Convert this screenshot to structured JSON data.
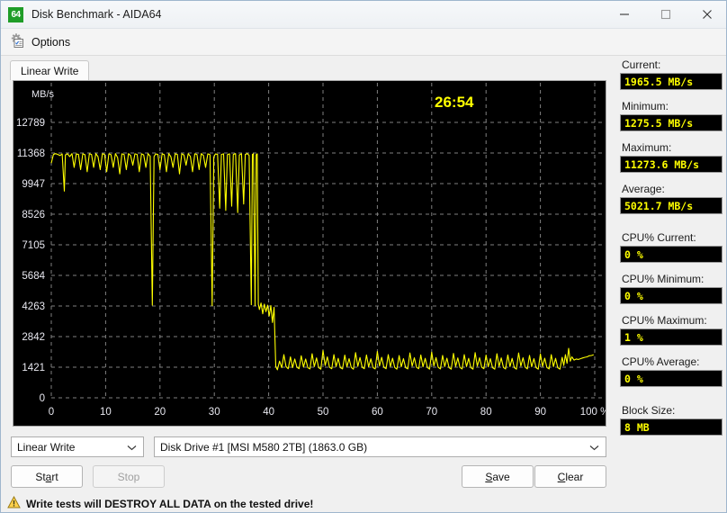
{
  "window": {
    "title": "Disk Benchmark - AIDA64",
    "app_icon": "64",
    "minimize_icon": "minimize-icon",
    "maximize_icon": "maximize-icon",
    "close_icon": "close-icon"
  },
  "toolbar": {
    "options_label": "Options",
    "options_icon": "gear-checklist-icon"
  },
  "tabs": [
    {
      "label": "Linear Write",
      "active": true
    }
  ],
  "chart": {
    "timer": "26:54",
    "y_axis_unit": "MB/s",
    "x_axis_unit": "%"
  },
  "chart_data": {
    "type": "line",
    "title": "Linear Write",
    "xlabel": "%",
    "ylabel": "MB/s",
    "xlim": [
      0,
      100
    ],
    "ylim": [
      0,
      14210
    ],
    "grid": true,
    "legend": "none",
    "line_color": "#ffff00",
    "background": "#000000",
    "gridline_color": "#808080",
    "xticks": [
      0,
      10,
      20,
      30,
      40,
      50,
      60,
      70,
      80,
      90,
      100
    ],
    "xtick_labels": [
      "0",
      "10",
      "20",
      "30",
      "40",
      "50",
      "60",
      "70",
      "80",
      "90",
      "100 %"
    ],
    "yticks": [
      0,
      1421,
      2842,
      4263,
      5684,
      7105,
      8526,
      9947,
      11368,
      12789
    ],
    "ytick_labels": [
      "0",
      "1421",
      "2842",
      "4263",
      "5684",
      "7105",
      "8526",
      "9947",
      "11368",
      "12789"
    ],
    "annotations": [
      {
        "text": "26:54",
        "x": 72,
        "y": 13400,
        "color": "#ffff00"
      }
    ],
    "series": [
      {
        "name": "Linear Write speed",
        "points": [
          [
            0.0,
            10900
          ],
          [
            0.4,
            11300
          ],
          [
            0.8,
            11340
          ],
          [
            1.2,
            11300
          ],
          [
            1.6,
            11250
          ],
          [
            2.0,
            11320
          ],
          [
            2.4,
            9600
          ],
          [
            2.6,
            11280
          ],
          [
            3.0,
            11330
          ],
          [
            3.4,
            11200
          ],
          [
            3.8,
            11340
          ],
          [
            4.2,
            10700
          ],
          [
            4.6,
            11320
          ],
          [
            5.0,
            11300
          ],
          [
            5.4,
            10600
          ],
          [
            5.8,
            11330
          ],
          [
            6.2,
            11290
          ],
          [
            6.6,
            10500
          ],
          [
            7.0,
            11330
          ],
          [
            7.4,
            11300
          ],
          [
            7.8,
            10700
          ],
          [
            8.2,
            11340
          ],
          [
            8.6,
            11200
          ],
          [
            9.0,
            10600
          ],
          [
            9.4,
            11330
          ],
          [
            9.8,
            11310
          ],
          [
            10.2,
            10500
          ],
          [
            10.6,
            11330
          ],
          [
            11.0,
            11290
          ],
          [
            11.4,
            10700
          ],
          [
            11.8,
            11340
          ],
          [
            12.2,
            11160
          ],
          [
            12.6,
            10400
          ],
          [
            13.0,
            11330
          ],
          [
            13.4,
            11300
          ],
          [
            13.8,
            10600
          ],
          [
            14.2,
            11340
          ],
          [
            14.6,
            11250
          ],
          [
            15.0,
            10800
          ],
          [
            15.4,
            11330
          ],
          [
            15.8,
            11300
          ],
          [
            16.2,
            10500
          ],
          [
            16.6,
            11330
          ],
          [
            17.0,
            11280
          ],
          [
            17.4,
            10700
          ],
          [
            17.8,
            11340
          ],
          [
            18.2,
            11220
          ],
          [
            18.6,
            4300
          ],
          [
            18.9,
            11200
          ],
          [
            19.2,
            11320
          ],
          [
            19.6,
            11300
          ],
          [
            20.0,
            10600
          ],
          [
            20.4,
            11330
          ],
          [
            20.8,
            11290
          ],
          [
            21.2,
            10500
          ],
          [
            21.6,
            11340
          ],
          [
            22.0,
            11200
          ],
          [
            22.4,
            10700
          ],
          [
            22.8,
            11330
          ],
          [
            23.2,
            11300
          ],
          [
            23.6,
            10400
          ],
          [
            24.0,
            11330
          ],
          [
            24.4,
            11280
          ],
          [
            24.8,
            10800
          ],
          [
            25.2,
            11340
          ],
          [
            25.6,
            11210
          ],
          [
            26.0,
            10500
          ],
          [
            26.4,
            11330
          ],
          [
            26.8,
            11300
          ],
          [
            27.2,
            10600
          ],
          [
            27.6,
            11340
          ],
          [
            28.0,
            11250
          ],
          [
            28.4,
            10700
          ],
          [
            28.8,
            11330
          ],
          [
            29.2,
            11290
          ],
          [
            29.6,
            4280
          ],
          [
            29.9,
            11180
          ],
          [
            30.2,
            11320
          ],
          [
            30.6,
            11300
          ],
          [
            31.0,
            8800
          ],
          [
            31.3,
            11300
          ],
          [
            31.7,
            11330
          ],
          [
            32.1,
            8700
          ],
          [
            32.4,
            11290
          ],
          [
            32.8,
            11330
          ],
          [
            33.2,
            8900
          ],
          [
            33.5,
            11300
          ],
          [
            33.9,
            11340
          ],
          [
            34.3,
            8600
          ],
          [
            34.6,
            11280
          ],
          [
            35.0,
            11330
          ],
          [
            35.4,
            9000
          ],
          [
            35.7,
            11300
          ],
          [
            36.1,
            11340
          ],
          [
            36.4,
            11250
          ],
          [
            36.8,
            4320
          ],
          [
            37.0,
            11300
          ],
          [
            37.2,
            11330
          ],
          [
            37.5,
            4280
          ],
          [
            37.7,
            11290
          ],
          [
            37.9,
            11330
          ],
          [
            38.1,
            4350
          ],
          [
            38.3,
            4100
          ],
          [
            38.6,
            4400
          ],
          [
            38.9,
            3900
          ],
          [
            39.2,
            4350
          ],
          [
            39.5,
            4000
          ],
          [
            39.8,
            4300
          ],
          [
            40.1,
            3800
          ],
          [
            40.4,
            4280
          ],
          [
            40.7,
            3500
          ],
          [
            41.0,
            4200
          ],
          [
            41.3,
            1450
          ],
          [
            41.6,
            1300
          ],
          [
            42.0,
            1700
          ],
          [
            42.4,
            1400
          ],
          [
            42.8,
            2000
          ],
          [
            43.2,
            1450
          ],
          [
            43.6,
            1350
          ],
          [
            44.0,
            1900
          ],
          [
            44.4,
            1400
          ],
          [
            44.8,
            1800
          ],
          [
            45.2,
            1420
          ],
          [
            45.6,
            1350
          ],
          [
            46.0,
            1950
          ],
          [
            46.4,
            1430
          ],
          [
            46.8,
            1800
          ],
          [
            47.2,
            1400
          ],
          [
            47.6,
            1340
          ],
          [
            48.0,
            2050
          ],
          [
            48.4,
            1450
          ],
          [
            48.8,
            1850
          ],
          [
            49.2,
            1400
          ],
          [
            49.6,
            1330
          ],
          [
            50.0,
            2200
          ],
          [
            50.4,
            1500
          ],
          [
            50.8,
            1900
          ],
          [
            51.2,
            1420
          ],
          [
            51.6,
            1350
          ],
          [
            52.0,
            2000
          ],
          [
            52.4,
            1450
          ],
          [
            52.8,
            1830
          ],
          [
            53.2,
            1400
          ],
          [
            53.6,
            1340
          ],
          [
            54.0,
            1980
          ],
          [
            54.4,
            1440
          ],
          [
            54.8,
            1820
          ],
          [
            55.2,
            1410
          ],
          [
            55.6,
            1330
          ],
          [
            56.0,
            2100
          ],
          [
            56.4,
            1460
          ],
          [
            56.8,
            1870
          ],
          [
            57.2,
            1420
          ],
          [
            57.6,
            1350
          ],
          [
            58.0,
            1990
          ],
          [
            58.4,
            1440
          ],
          [
            58.8,
            1810
          ],
          [
            59.2,
            1400
          ],
          [
            59.6,
            1340
          ],
          [
            60.0,
            2150
          ],
          [
            60.4,
            1480
          ],
          [
            60.8,
            1880
          ],
          [
            61.2,
            1420
          ],
          [
            61.6,
            1350
          ],
          [
            62.0,
            2000
          ],
          [
            62.4,
            1450
          ],
          [
            62.8,
            1840
          ],
          [
            63.2,
            1410
          ],
          [
            63.6,
            1330
          ],
          [
            64.0,
            1960
          ],
          [
            64.4,
            1440
          ],
          [
            64.8,
            1820
          ],
          [
            65.2,
            1400
          ],
          [
            65.6,
            1340
          ],
          [
            66.0,
            2080
          ],
          [
            66.4,
            1470
          ],
          [
            66.8,
            1860
          ],
          [
            67.2,
            1420
          ],
          [
            67.6,
            1350
          ],
          [
            68.0,
            1990
          ],
          [
            68.4,
            1440
          ],
          [
            68.8,
            1830
          ],
          [
            69.2,
            1410
          ],
          [
            69.6,
            1330
          ],
          [
            70.0,
            2120
          ],
          [
            70.4,
            1480
          ],
          [
            70.8,
            1870
          ],
          [
            71.2,
            1420
          ],
          [
            71.6,
            1340
          ],
          [
            72.0,
            1970
          ],
          [
            72.4,
            1450
          ],
          [
            72.8,
            1840
          ],
          [
            73.2,
            1400
          ],
          [
            73.6,
            1330
          ],
          [
            74.0,
            2060
          ],
          [
            74.4,
            1460
          ],
          [
            74.8,
            1850
          ],
          [
            75.2,
            1410
          ],
          [
            75.6,
            1340
          ],
          [
            76.0,
            2000
          ],
          [
            76.4,
            1450
          ],
          [
            76.8,
            1830
          ],
          [
            77.2,
            1400
          ],
          [
            77.6,
            1330
          ],
          [
            78.0,
            2100
          ],
          [
            78.4,
            1470
          ],
          [
            78.8,
            1860
          ],
          [
            79.2,
            1420
          ],
          [
            79.6,
            1350
          ],
          [
            80.0,
            1980
          ],
          [
            80.4,
            1440
          ],
          [
            80.8,
            1820
          ],
          [
            81.2,
            1400
          ],
          [
            81.6,
            1330
          ],
          [
            82.0,
            2050
          ],
          [
            82.4,
            1460
          ],
          [
            82.8,
            1850
          ],
          [
            83.2,
            1410
          ],
          [
            83.6,
            1340
          ],
          [
            84.0,
            1990
          ],
          [
            84.4,
            1450
          ],
          [
            84.8,
            1830
          ],
          [
            85.2,
            1400
          ],
          [
            85.6,
            1330
          ],
          [
            86.0,
            2080
          ],
          [
            86.4,
            1470
          ],
          [
            86.8,
            1860
          ],
          [
            87.2,
            1420
          ],
          [
            87.6,
            1340
          ],
          [
            88.0,
            1970
          ],
          [
            88.4,
            1440
          ],
          [
            88.8,
            1820
          ],
          [
            89.2,
            1400
          ],
          [
            89.6,
            1330
          ],
          [
            90.0,
            2040
          ],
          [
            90.4,
            1460
          ],
          [
            90.8,
            1840
          ],
          [
            91.2,
            1410
          ],
          [
            91.6,
            1340
          ],
          [
            92.0,
            2000
          ],
          [
            92.4,
            1450
          ],
          [
            92.8,
            1830
          ],
          [
            93.2,
            1400
          ],
          [
            93.6,
            1330
          ],
          [
            94.0,
            1880
          ],
          [
            94.3,
            1500
          ],
          [
            94.6,
            2000
          ],
          [
            94.9,
            1600
          ],
          [
            95.2,
            2300
          ],
          [
            95.5,
            1700
          ],
          [
            95.8,
            1900
          ],
          [
            96.2,
            1750
          ],
          [
            96.6,
            1800
          ],
          [
            97.0,
            1780
          ],
          [
            97.4,
            1820
          ],
          [
            97.8,
            1850
          ],
          [
            98.2,
            1880
          ],
          [
            98.6,
            1900
          ],
          [
            99.0,
            1950
          ],
          [
            99.4,
            1965
          ],
          [
            99.8,
            2000
          ]
        ]
      }
    ]
  },
  "stats": [
    {
      "label": "Current:",
      "value": "1965.5 MB/s",
      "group_end": false
    },
    {
      "label": "Minimum:",
      "value": "1275.5 MB/s",
      "group_end": false
    },
    {
      "label": "Maximum:",
      "value": "11273.6 MB/s",
      "group_end": false
    },
    {
      "label": "Average:",
      "value": "5021.7 MB/s",
      "group_end": true
    },
    {
      "label": "CPU% Current:",
      "value": "0 %",
      "group_end": false
    },
    {
      "label": "CPU% Minimum:",
      "value": "0 %",
      "group_end": false
    },
    {
      "label": "CPU% Maximum:",
      "value": "1 %",
      "group_end": false
    },
    {
      "label": "CPU% Average:",
      "value": "0 %",
      "group_end": true
    },
    {
      "label": "Block Size:",
      "value": "8 MB",
      "group_end": false
    }
  ],
  "controls": {
    "test_select_value": "Linear Write",
    "drive_select_value": "Disk Drive #1  [MSI M580 2TB]  (1863.0 GB)",
    "dropdown_icon": "chevron-down-icon",
    "start_label": "Start",
    "stop_label": "Stop",
    "save_label": "Save",
    "clear_label": "Clear",
    "stop_disabled": true
  },
  "warning": {
    "icon": "warning-triangle-icon",
    "text": "Write tests will DESTROY ALL DATA on the tested drive!"
  }
}
